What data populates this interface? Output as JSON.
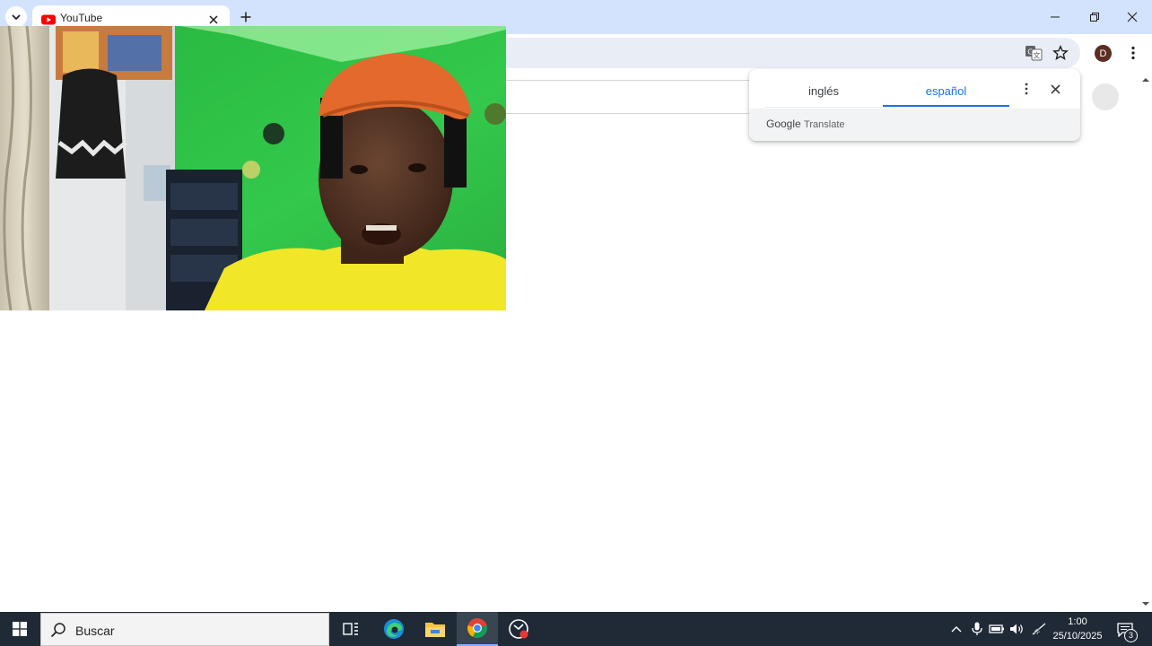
{
  "browser": {
    "tab": {
      "title": "YouTube",
      "favicon": "youtube-icon"
    },
    "new_tab_icon": "plus-icon",
    "window_controls": [
      "minimize-icon",
      "restore-icon",
      "close-icon"
    ],
    "toolbar_icons": [
      "translate-icon",
      "bookmark-star-icon",
      "profile-avatar",
      "menu-kebab-icon"
    ],
    "profile_initial": "D"
  },
  "translate_popup": {
    "source_language": "inglés",
    "target_language": "español",
    "brand_google": "Google",
    "brand_translate": "Translate",
    "accent_color": "#1a73e8"
  },
  "webcam": {
    "description_icon": "webcam-video-feed"
  },
  "taskbar": {
    "search_placeholder": "Buscar",
    "pinned_apps": [
      "task-view-icon",
      "edge-icon",
      "file-explorer-icon",
      "chrome-icon",
      "recorder-icon"
    ],
    "active_app": "chrome-icon",
    "tray_icons": [
      "chevron-up-icon",
      "microphone-icon",
      "battery-icon",
      "volume-icon",
      "network-icon"
    ],
    "clock_time": "1:00",
    "clock_date": "25/10/2025",
    "notification_count": "3"
  },
  "colors": {
    "tabstrip_bg": "#d3e3fd",
    "taskbar_bg": "#1f2a36",
    "webcam_wall_green": "#2fc449",
    "shirt_yellow": "#f2e629",
    "cap_orange": "#e36a2c"
  }
}
